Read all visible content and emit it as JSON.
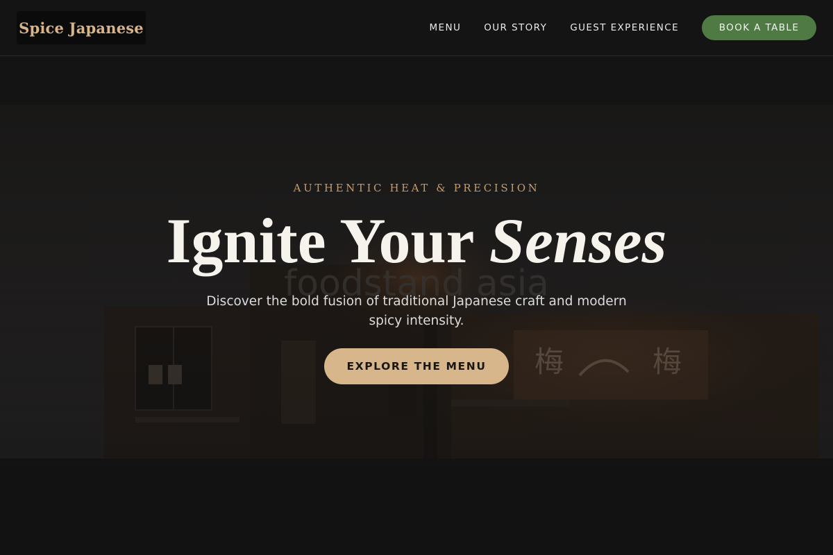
{
  "brand": {
    "logo_text": "Spice Japanese",
    "accent_color": "#d8b48a",
    "green_color": "#507a44"
  },
  "nav": {
    "links": [
      {
        "label": "MENU"
      },
      {
        "label": "OUR STORY"
      },
      {
        "label": "GUEST EXPERIENCE"
      }
    ],
    "cta_label": "BOOK A TABLE"
  },
  "hero": {
    "eyebrow": "AUTHENTIC HEAT & PRECISION",
    "headline_plain": "Ignite Your",
    "headline_accent": "Senses",
    "subtitle": "Discover the bold fusion of traditional Japanese craft and modern spicy intensity.",
    "cta_label": "EXPLORE THE MENU",
    "background": {
      "image_kind": "dim street-front photo of a Japanese restaurant at night",
      "sign_text": "foodstand asia"
    }
  }
}
